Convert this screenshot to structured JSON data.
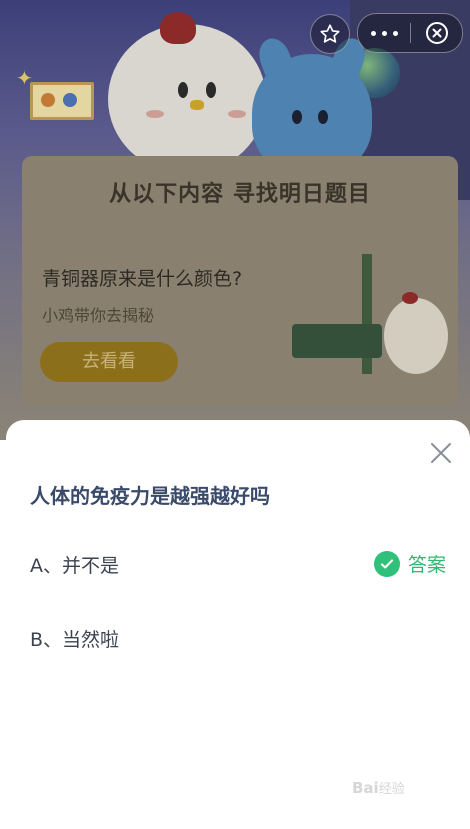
{
  "banner": {
    "heading": "从以下内容 寻找明日题目"
  },
  "card": {
    "title": "青铜器原来是什么颜色?",
    "subtitle": "小鸡带你去揭秘",
    "button_label": "去看看"
  },
  "quiz": {
    "question": "人体的免疫力是越强越好吗",
    "options": [
      {
        "label": "A、并不是"
      },
      {
        "label": "B、当然啦"
      }
    ],
    "answer_badge": "答案"
  },
  "watermark": {
    "brand": "Bai",
    "suffix": "经验"
  },
  "colors": {
    "accent_green": "#2fc07a",
    "question_text": "#3a4a6b"
  },
  "icons": [
    "star-icon",
    "more-icon",
    "close-circle-icon",
    "close-icon",
    "check-circle-icon"
  ]
}
